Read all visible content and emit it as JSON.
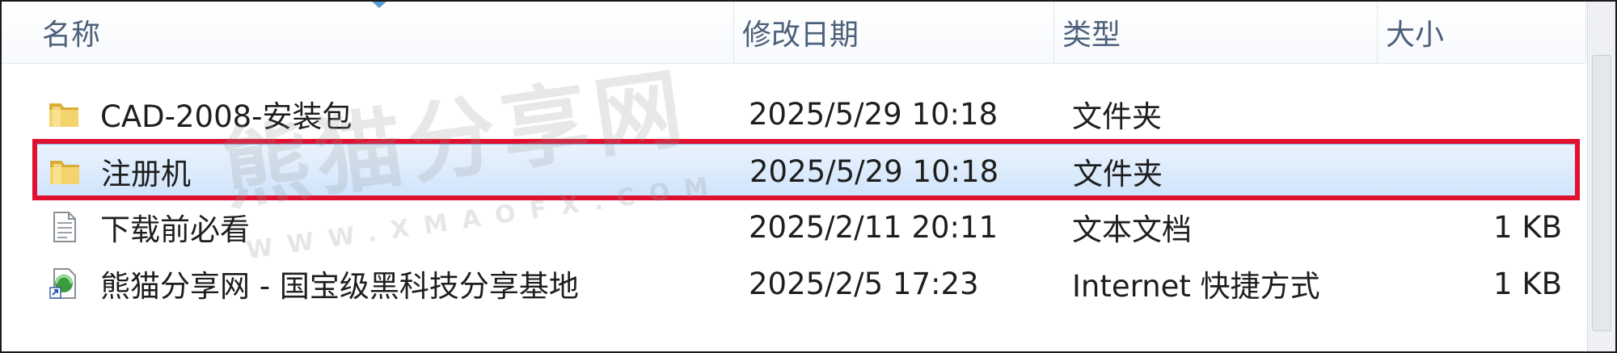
{
  "columns": {
    "name": "名称",
    "modified": "修改日期",
    "type": "类型",
    "size": "大小"
  },
  "files": [
    {
      "name": "CAD-2008-安装包",
      "modified": "2025/5/29 10:18",
      "type": "文件夹",
      "size": "",
      "icon": "folder-icon"
    },
    {
      "name": "注册机",
      "modified": "2025/5/29 10:18",
      "type": "文件夹",
      "size": "",
      "icon": "folder-icon",
      "selected": true
    },
    {
      "name": "下载前必看",
      "modified": "2025/2/11 20:11",
      "type": "文本文档",
      "size": "1 KB",
      "icon": "text-file-icon"
    },
    {
      "name": "熊猫分享网 - 国宝级黑科技分享基地",
      "modified": "2025/2/5 17:23",
      "type": "Internet 快捷方式",
      "size": "1 KB",
      "icon": "internet-shortcut-icon"
    }
  ],
  "watermark": {
    "title": "熊猫分享网",
    "url": "WWW.XMAOFX.COM"
  },
  "colors": {
    "highlight": "#e0102f",
    "selection": "#cfe4fb",
    "folder": "#e7c04a"
  }
}
